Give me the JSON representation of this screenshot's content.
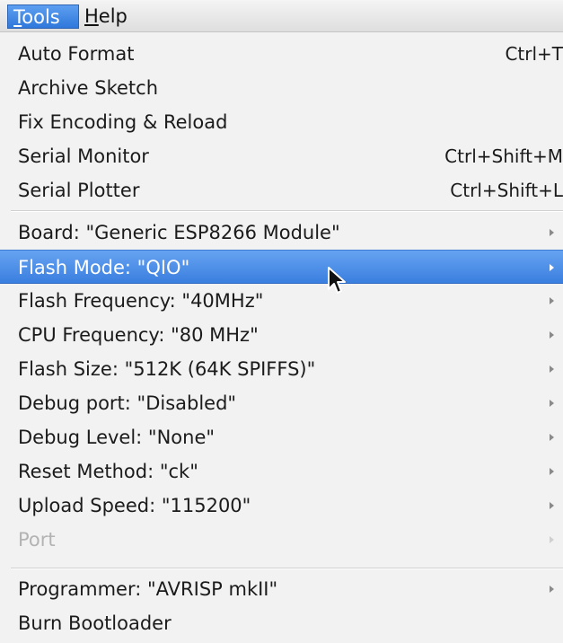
{
  "menubar": {
    "tools_label": "Tools",
    "help_label": "Help"
  },
  "menu": {
    "auto_format": {
      "label": "Auto Format",
      "shortcut": "Ctrl+T"
    },
    "archive_sketch": {
      "label": "Archive Sketch"
    },
    "fix_encoding": {
      "label": "Fix Encoding & Reload"
    },
    "serial_monitor": {
      "label": "Serial Monitor",
      "shortcut": "Ctrl+Shift+M"
    },
    "serial_plotter": {
      "label": "Serial Plotter",
      "shortcut": "Ctrl+Shift+L"
    },
    "board": {
      "label": "Board: \"Generic ESP8266 Module\""
    },
    "flash_mode": {
      "label": "Flash Mode: \"QIO\""
    },
    "flash_frequency": {
      "label": "Flash Frequency: \"40MHz\""
    },
    "cpu_frequency": {
      "label": "CPU Frequency: \"80 MHz\""
    },
    "flash_size": {
      "label": "Flash Size: \"512K (64K SPIFFS)\""
    },
    "debug_port": {
      "label": "Debug port: \"Disabled\""
    },
    "debug_level": {
      "label": "Debug Level: \"None\""
    },
    "reset_method": {
      "label": "Reset Method: \"ck\""
    },
    "upload_speed": {
      "label": "Upload Speed: \"115200\""
    },
    "port": {
      "label": "Port"
    },
    "programmer": {
      "label": "Programmer: \"AVRISP mkII\""
    },
    "burn_bootloader": {
      "label": "Burn Bootloader"
    }
  },
  "colors": {
    "highlight": "#3a7fdf",
    "menubar_active": "#2f78db",
    "disabled_text": "#b3b3b3",
    "submenu_arrow": "#8a8a8a"
  },
  "icons": {
    "submenu_indicator": "chevron-right-icon",
    "cursor": "mouse-pointer-icon"
  }
}
